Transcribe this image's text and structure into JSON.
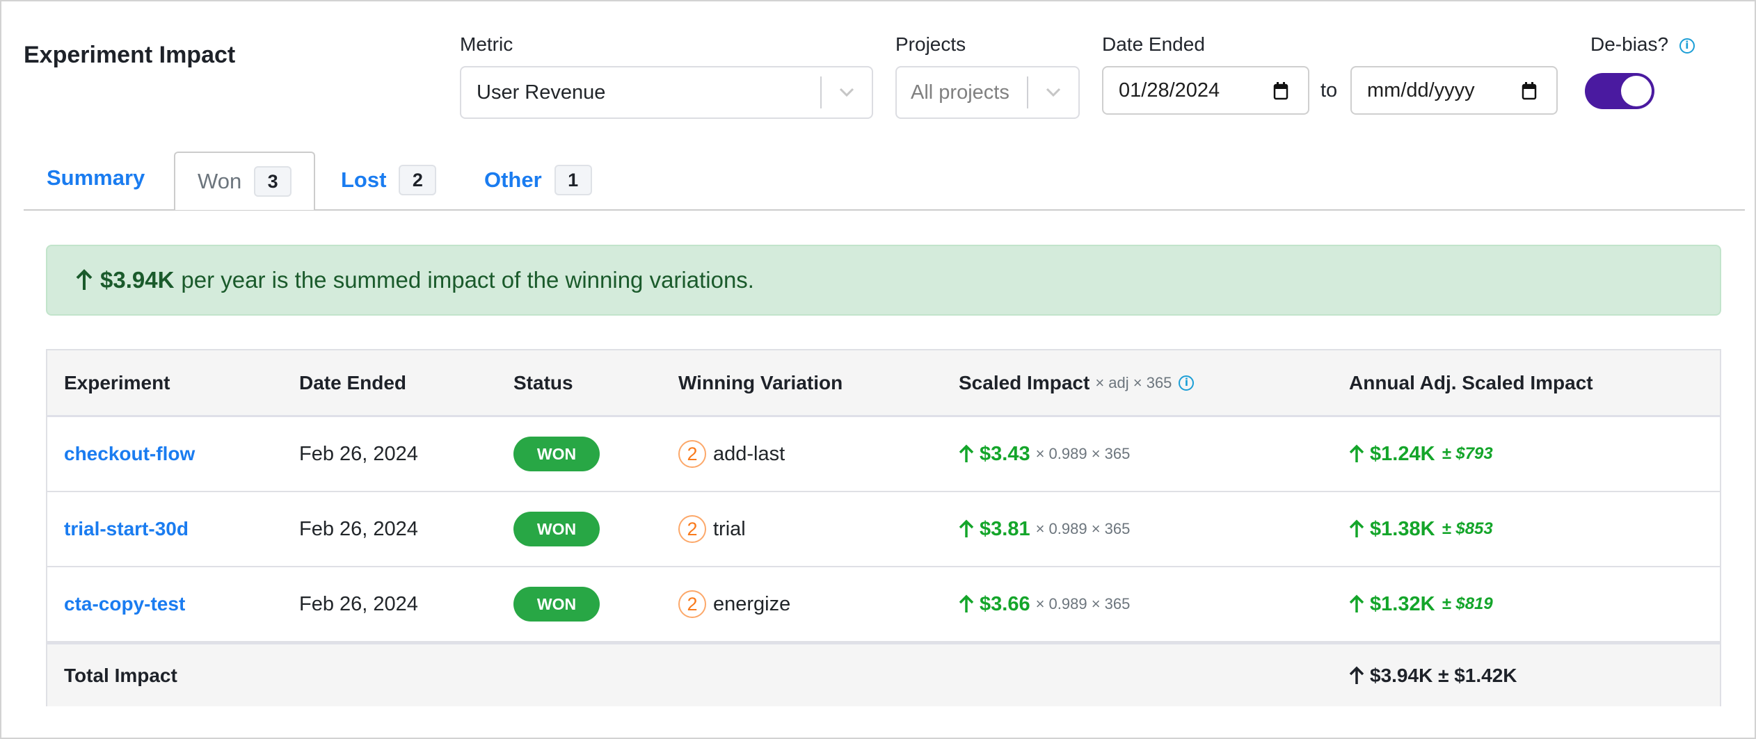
{
  "header": {
    "title": "Experiment Impact"
  },
  "filters": {
    "metric": {
      "label": "Metric",
      "value": "User Revenue"
    },
    "projects": {
      "label": "Projects",
      "placeholder": "All projects"
    },
    "date_ended": {
      "label": "Date Ended",
      "from_value": "01/28/2024",
      "to_label": "to",
      "to_placeholder": "mm/dd/yyyy"
    },
    "debias": {
      "label": "De-bias?",
      "enabled": true,
      "info_icon": "info-icon"
    }
  },
  "tabs": [
    {
      "label": "Summary",
      "count": null,
      "active": false
    },
    {
      "label": "Won",
      "count": "3",
      "active": true
    },
    {
      "label": "Lost",
      "count": "2",
      "active": false
    },
    {
      "label": "Other",
      "count": "1",
      "active": false
    }
  ],
  "alert": {
    "icon": "arrow-up-icon",
    "amount": "$3.94K",
    "text": "per year is the summed impact of the winning variations."
  },
  "table": {
    "columns": {
      "experiment": "Experiment",
      "date_ended": "Date Ended",
      "status": "Status",
      "winning_variation": "Winning Variation",
      "scaled_impact": "Scaled Impact",
      "scaled_impact_sub": "× adj × 365",
      "annual": "Annual Adj. Scaled Impact"
    },
    "rows": [
      {
        "experiment": "checkout-flow",
        "date_ended": "Feb 26, 2024",
        "status": "WON",
        "variation_num": "2",
        "variation_name": "add-last",
        "scaled_impact": "$3.43",
        "multiplier": "× 0.989 × 365",
        "annual": "$1.24K",
        "annual_ci": "± $793"
      },
      {
        "experiment": "trial-start-30d",
        "date_ended": "Feb 26, 2024",
        "status": "WON",
        "variation_num": "2",
        "variation_name": "trial",
        "scaled_impact": "$3.81",
        "multiplier": "× 0.989 × 365",
        "annual": "$1.38K",
        "annual_ci": "± $853"
      },
      {
        "experiment": "cta-copy-test",
        "date_ended": "Feb 26, 2024",
        "status": "WON",
        "variation_num": "2",
        "variation_name": "energize",
        "scaled_impact": "$3.66",
        "multiplier": "× 0.989 × 365",
        "annual": "$1.32K",
        "annual_ci": "± $819"
      }
    ],
    "total": {
      "label": "Total Impact",
      "value": "$3.94K ± $1.42K"
    }
  },
  "colors": {
    "accent_blue": "#1a7cf0",
    "toggle_purple": "#4a1aa0",
    "won_green": "#28a745",
    "impact_green": "#14a52a",
    "alert_bg": "#d4ebdb",
    "variation_orange": "#f97a1c",
    "info_blue": "#1b9ed6"
  }
}
